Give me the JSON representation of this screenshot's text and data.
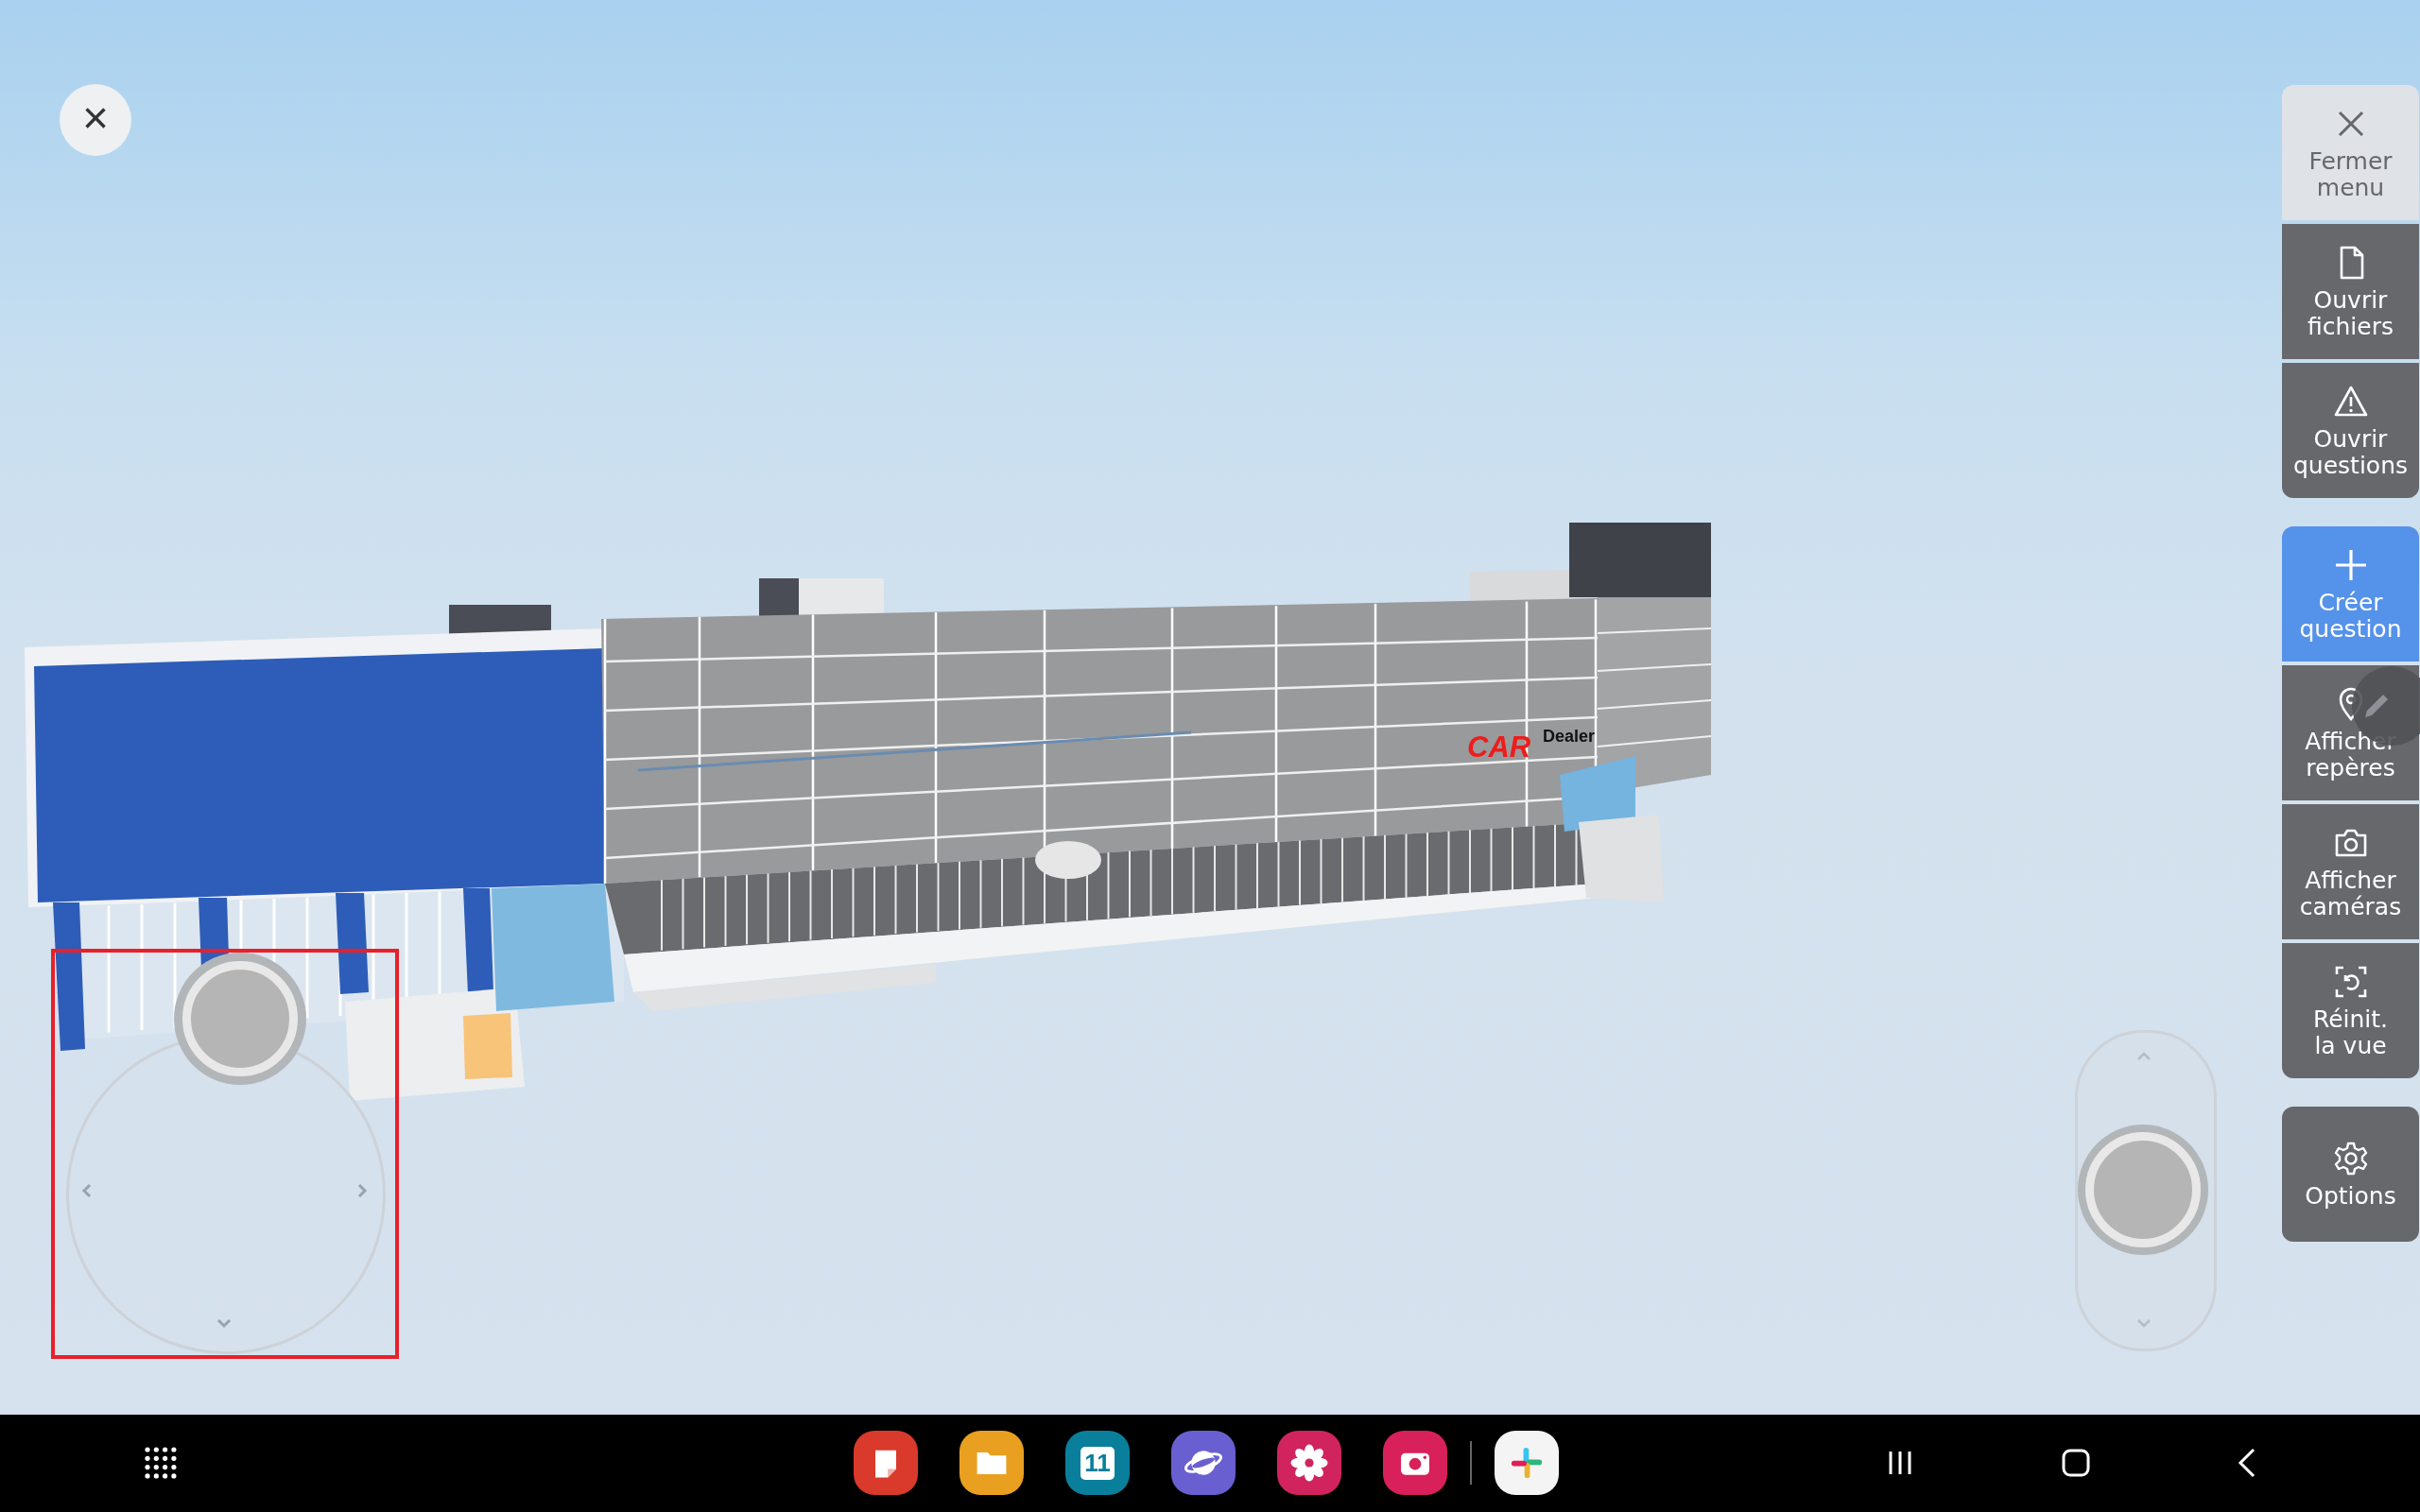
{
  "close_button": {
    "label": "×"
  },
  "model": {
    "signs": [
      {
        "kind": "brand",
        "text": "CAR"
      },
      {
        "kind": "subtitle",
        "text": "Dealer"
      }
    ]
  },
  "menu": {
    "groups": [
      [
        {
          "kind": "close",
          "label": "Fermer menu"
        },
        {
          "kind": "files",
          "label": "Ouvrir fichiers"
        },
        {
          "kind": "questions",
          "label": "Ouvrir questions"
        }
      ],
      [
        {
          "kind": "create",
          "label": "Créer question"
        },
        {
          "kind": "markers",
          "label": "Afficher repères"
        },
        {
          "kind": "cameras",
          "label": "Afficher caméras"
        },
        {
          "kind": "reset",
          "label": "Réinit.\nla vue"
        }
      ],
      [
        {
          "kind": "options",
          "label": "Options"
        }
      ]
    ]
  },
  "taskbar": {
    "apps": [
      {
        "kind": "notes"
      },
      {
        "kind": "folder"
      },
      {
        "kind": "calendar",
        "label": "11"
      },
      {
        "kind": "browser"
      },
      {
        "kind": "flower"
      },
      {
        "kind": "camera"
      },
      {
        "kind": "divider"
      },
      {
        "kind": "chat"
      }
    ]
  }
}
